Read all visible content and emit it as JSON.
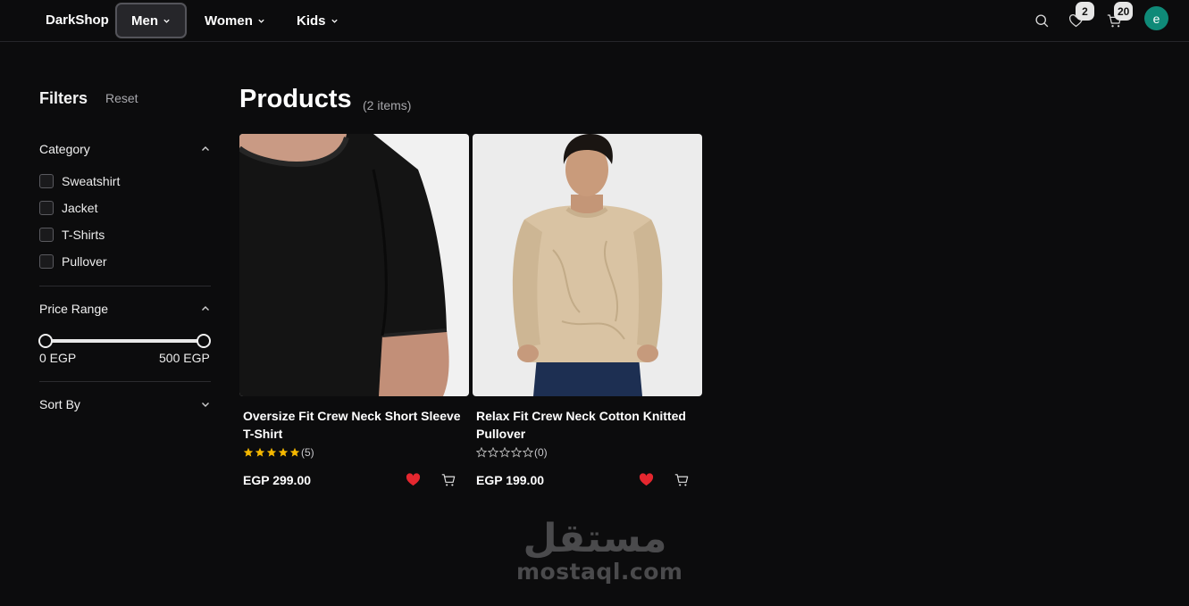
{
  "header": {
    "brand": "DarkShop",
    "nav": [
      {
        "label": "Men",
        "active": true
      },
      {
        "label": "Women",
        "active": false
      },
      {
        "label": "Kids",
        "active": false
      }
    ],
    "wishlist_count": "2",
    "cart_count": "20",
    "avatar_letter": "e"
  },
  "sidebar": {
    "title": "Filters",
    "reset_label": "Reset",
    "category": {
      "title": "Category",
      "items": [
        "Sweatshirt",
        "Jacket",
        "T-Shirts",
        "Pullover"
      ]
    },
    "price_range": {
      "title": "Price Range",
      "min_label": "0 EGP",
      "max_label": "500 EGP",
      "min": 0,
      "max": 500
    },
    "sort": {
      "title": "Sort By"
    }
  },
  "main": {
    "title": "Products",
    "count_label": "(2 items)",
    "products": [
      {
        "name": "Oversize Fit Crew Neck Short Sleeve T-Shirt",
        "rating": 5,
        "review_count": "(5)",
        "price": "EGP 299.00",
        "favorited": true,
        "image_icon": "black-tshirt-image"
      },
      {
        "name": "Relax Fit Crew Neck Cotton Knitted Pullover",
        "rating": 0,
        "review_count": "(0)",
        "price": "EGP 199.00",
        "favorited": true,
        "image_icon": "beige-pullover-image"
      }
    ]
  },
  "watermark": {
    "arabic": "مستقل",
    "latin": "mostaql.com"
  },
  "colors": {
    "background": "#0c0c0d",
    "accent_heart": "#e5272f",
    "star": "#f5b800",
    "avatar": "#0f8a78"
  }
}
